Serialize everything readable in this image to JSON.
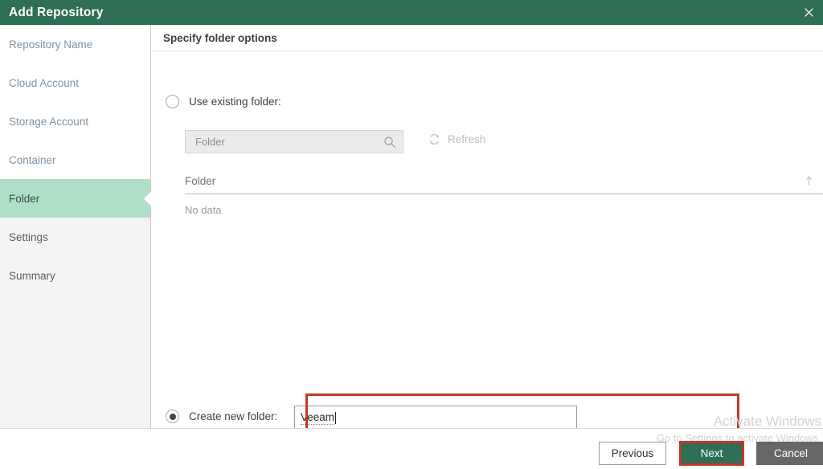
{
  "window": {
    "title": "Add Repository",
    "close_icon": "close-icon",
    "titlebar_color": "#2d6e54"
  },
  "sidebar": {
    "items": [
      {
        "label": "Repository Name",
        "active": false,
        "group": "upper"
      },
      {
        "label": "Cloud Account",
        "active": false,
        "group": "upper"
      },
      {
        "label": "Storage Account",
        "active": false,
        "group": "upper"
      },
      {
        "label": "Container",
        "active": false,
        "group": "upper"
      },
      {
        "label": "Folder",
        "active": true,
        "group": "upper"
      },
      {
        "label": "Settings",
        "active": false,
        "group": "lower"
      },
      {
        "label": "Summary",
        "active": false,
        "group": "lower"
      }
    ],
    "active_color": "#aee0c8"
  },
  "content": {
    "header_title": "Specify folder options",
    "use_existing": {
      "label": "Use existing folder:",
      "selected": false
    },
    "search": {
      "placeholder": "Folder",
      "value": "",
      "icon": "search-icon"
    },
    "refresh": {
      "label": "Refresh",
      "icon": "refresh-icon",
      "disabled": true
    },
    "table": {
      "columns": [
        "Folder"
      ],
      "sort_indicator": "ascending",
      "rows": [],
      "empty_text": "No data"
    },
    "create_new": {
      "label": "Create new folder:",
      "selected": true,
      "value": "Veeam"
    },
    "annotation_color": "#c0392b"
  },
  "footer": {
    "previous_label": "Previous",
    "next_label": "Next",
    "cancel_label": "Cancel"
  },
  "watermark": {
    "line1": "Activate Windows",
    "line2": "Go to Settings to activate Windows."
  }
}
